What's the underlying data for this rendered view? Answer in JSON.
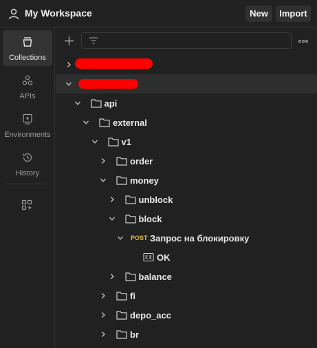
{
  "header": {
    "workspace": "My Workspace",
    "new_label": "New",
    "import_label": "Import"
  },
  "sidebar": {
    "items": [
      {
        "label": "Collections",
        "icon": "collections-icon",
        "active": true
      },
      {
        "label": "APIs",
        "icon": "apis-icon",
        "active": false
      },
      {
        "label": "Environments",
        "icon": "environments-icon",
        "active": false
      },
      {
        "label": "History",
        "icon": "history-icon",
        "active": false
      }
    ],
    "add_icon": "add-workspace-icon"
  },
  "toolbar": {
    "filter_placeholder": ""
  },
  "tree": [
    {
      "depth": 0,
      "type": "collection",
      "label": "",
      "expanded": false,
      "redacted": true
    },
    {
      "depth": 0,
      "type": "collection",
      "label": "",
      "expanded": true,
      "redacted": true
    },
    {
      "depth": 1,
      "type": "folder",
      "label": "api",
      "expanded": true
    },
    {
      "depth": 2,
      "type": "folder",
      "label": "external",
      "expanded": true
    },
    {
      "depth": 3,
      "type": "folder",
      "label": "v1",
      "expanded": true
    },
    {
      "depth": 4,
      "type": "folder",
      "label": "order",
      "expanded": false
    },
    {
      "depth": 4,
      "type": "folder",
      "label": "money",
      "expanded": true
    },
    {
      "depth": 5,
      "type": "folder",
      "label": "unblock",
      "expanded": false
    },
    {
      "depth": 5,
      "type": "folder",
      "label": "block",
      "expanded": true
    },
    {
      "depth": 6,
      "type": "request",
      "method": "POST",
      "label": "Запрос на блокировку",
      "expanded": true
    },
    {
      "depth": 7,
      "type": "example",
      "label": "OK"
    },
    {
      "depth": 5,
      "type": "folder",
      "label": "balance",
      "expanded": false
    },
    {
      "depth": 4,
      "type": "folder",
      "label": "fi",
      "expanded": false
    },
    {
      "depth": 4,
      "type": "folder",
      "label": "depo_acc",
      "expanded": false
    },
    {
      "depth": 4,
      "type": "folder",
      "label": "br",
      "expanded": false
    }
  ],
  "colors": {
    "background": "#212121",
    "active_item": "#333333",
    "method_post": "#e0b84b",
    "redaction": "#ff0000"
  }
}
